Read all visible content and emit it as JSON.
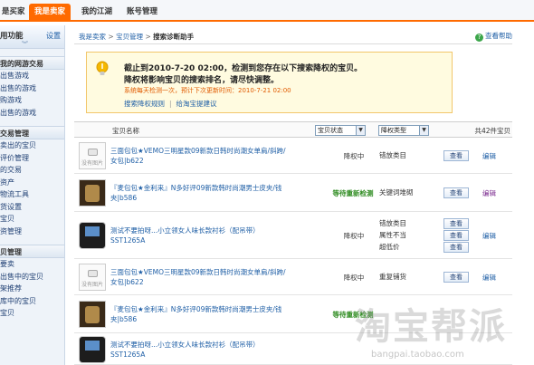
{
  "top_tabs": [
    "是买家",
    "我是卖家",
    "我的江湖",
    "账号管理"
  ],
  "sidebar": {
    "header_title": "用功能",
    "settings_label": "设置",
    "groups": [
      {
        "title": "我的网游交易",
        "items": [
          "出售游戏",
          "出售的游戏",
          "购游戏",
          "出售的游戏"
        ]
      },
      {
        "title": "交易管理",
        "items": [
          "卖出的宝贝",
          "评价管理",
          "的交易",
          "资产",
          "物流工具",
          "货设置",
          "宝贝",
          "资管理"
        ]
      },
      {
        "title": "贝管理",
        "items": [
          "要卖",
          "出售中的宝贝",
          "架推荐",
          "库中的宝贝",
          "宝贝"
        ]
      }
    ]
  },
  "breadcrumb": {
    "items": [
      "我是卖家",
      "宝贝管理"
    ],
    "current": "搜索诊断助手"
  },
  "help_label": "查看帮助",
  "notice": {
    "line1": "截止到2010-7-20 02:00，检测到您存在以下搜索降权的宝贝。",
    "line2": "降权将影响宝贝的搜索排名，请尽快调整。",
    "line3": "系统每天检测一次，预计下次更新时间：2010-7-21 02:00",
    "link1": "搜索降权规则",
    "link2": "给淘宝提建议"
  },
  "table": {
    "col_name": "宝贝名称",
    "status_filter": "宝贝状态",
    "type_filter": "降权类型",
    "total": "共42件宝贝",
    "no_image_label": "没有图片",
    "rows": [
      {
        "title": "三面包包★VEMO三明星款09新款日韩时尚潮女单肩/斜跨/女包|b622",
        "image": "none",
        "status": "降权中",
        "status_color": "#333333",
        "types": [
          "错放类目"
        ],
        "buttons": [
          "查看"
        ],
        "edit": "编辑",
        "edit_color": "#1f5fa6"
      },
      {
        "title": "『麦包包★金利来』N多好评09新款韩时尚潮男士皮夹/钱夹|b586",
        "image": "wallet",
        "status": "等待重新检测",
        "status_color": "#2c8a1e",
        "types": [
          "关键词堆砌"
        ],
        "buttons": [
          "查看"
        ],
        "edit": "编辑",
        "edit_color": "#7a2a8e"
      },
      {
        "title": "测试不要拍呀...小立领女人味长款衬衫（配吊带）SST1265A",
        "image": "phone",
        "status": "降权中",
        "status_color": "#333333",
        "types": [
          "错放类目",
          "属性不当",
          "超低价"
        ],
        "buttons": [
          "查看",
          "查看",
          "查看"
        ],
        "edit": "编辑",
        "edit_color": "#1f5fa6"
      },
      {
        "title": "三面包包★VEMO三明星款09新款日韩时尚潮女单肩/斜跨/女包|b622",
        "image": "none",
        "status": "降权中",
        "status_color": "#333333",
        "types": [
          "重复铺货"
        ],
        "buttons": [
          "查看"
        ],
        "edit": "编辑",
        "edit_color": "#1f5fa6"
      },
      {
        "title": "『麦包包★金利来』N多好评09新款韩时尚潮男士皮夹/钱夹|b586",
        "image": "wallet",
        "status": "等待重新检测",
        "status_color": "#2c8a1e",
        "types": [],
        "buttons": [],
        "edit": "",
        "edit_color": "#7a2a8e"
      },
      {
        "title": "测试不要拍呀...小立领女人味长款衬衫（配吊带）SST1265A",
        "image": "phone",
        "status": "",
        "status_color": "#333333",
        "types": [],
        "buttons": [],
        "edit": "",
        "edit_color": "#1f5fa6"
      }
    ]
  },
  "watermark": {
    "text": "淘宝帮派",
    "url": "bangpai.taobao.com"
  }
}
